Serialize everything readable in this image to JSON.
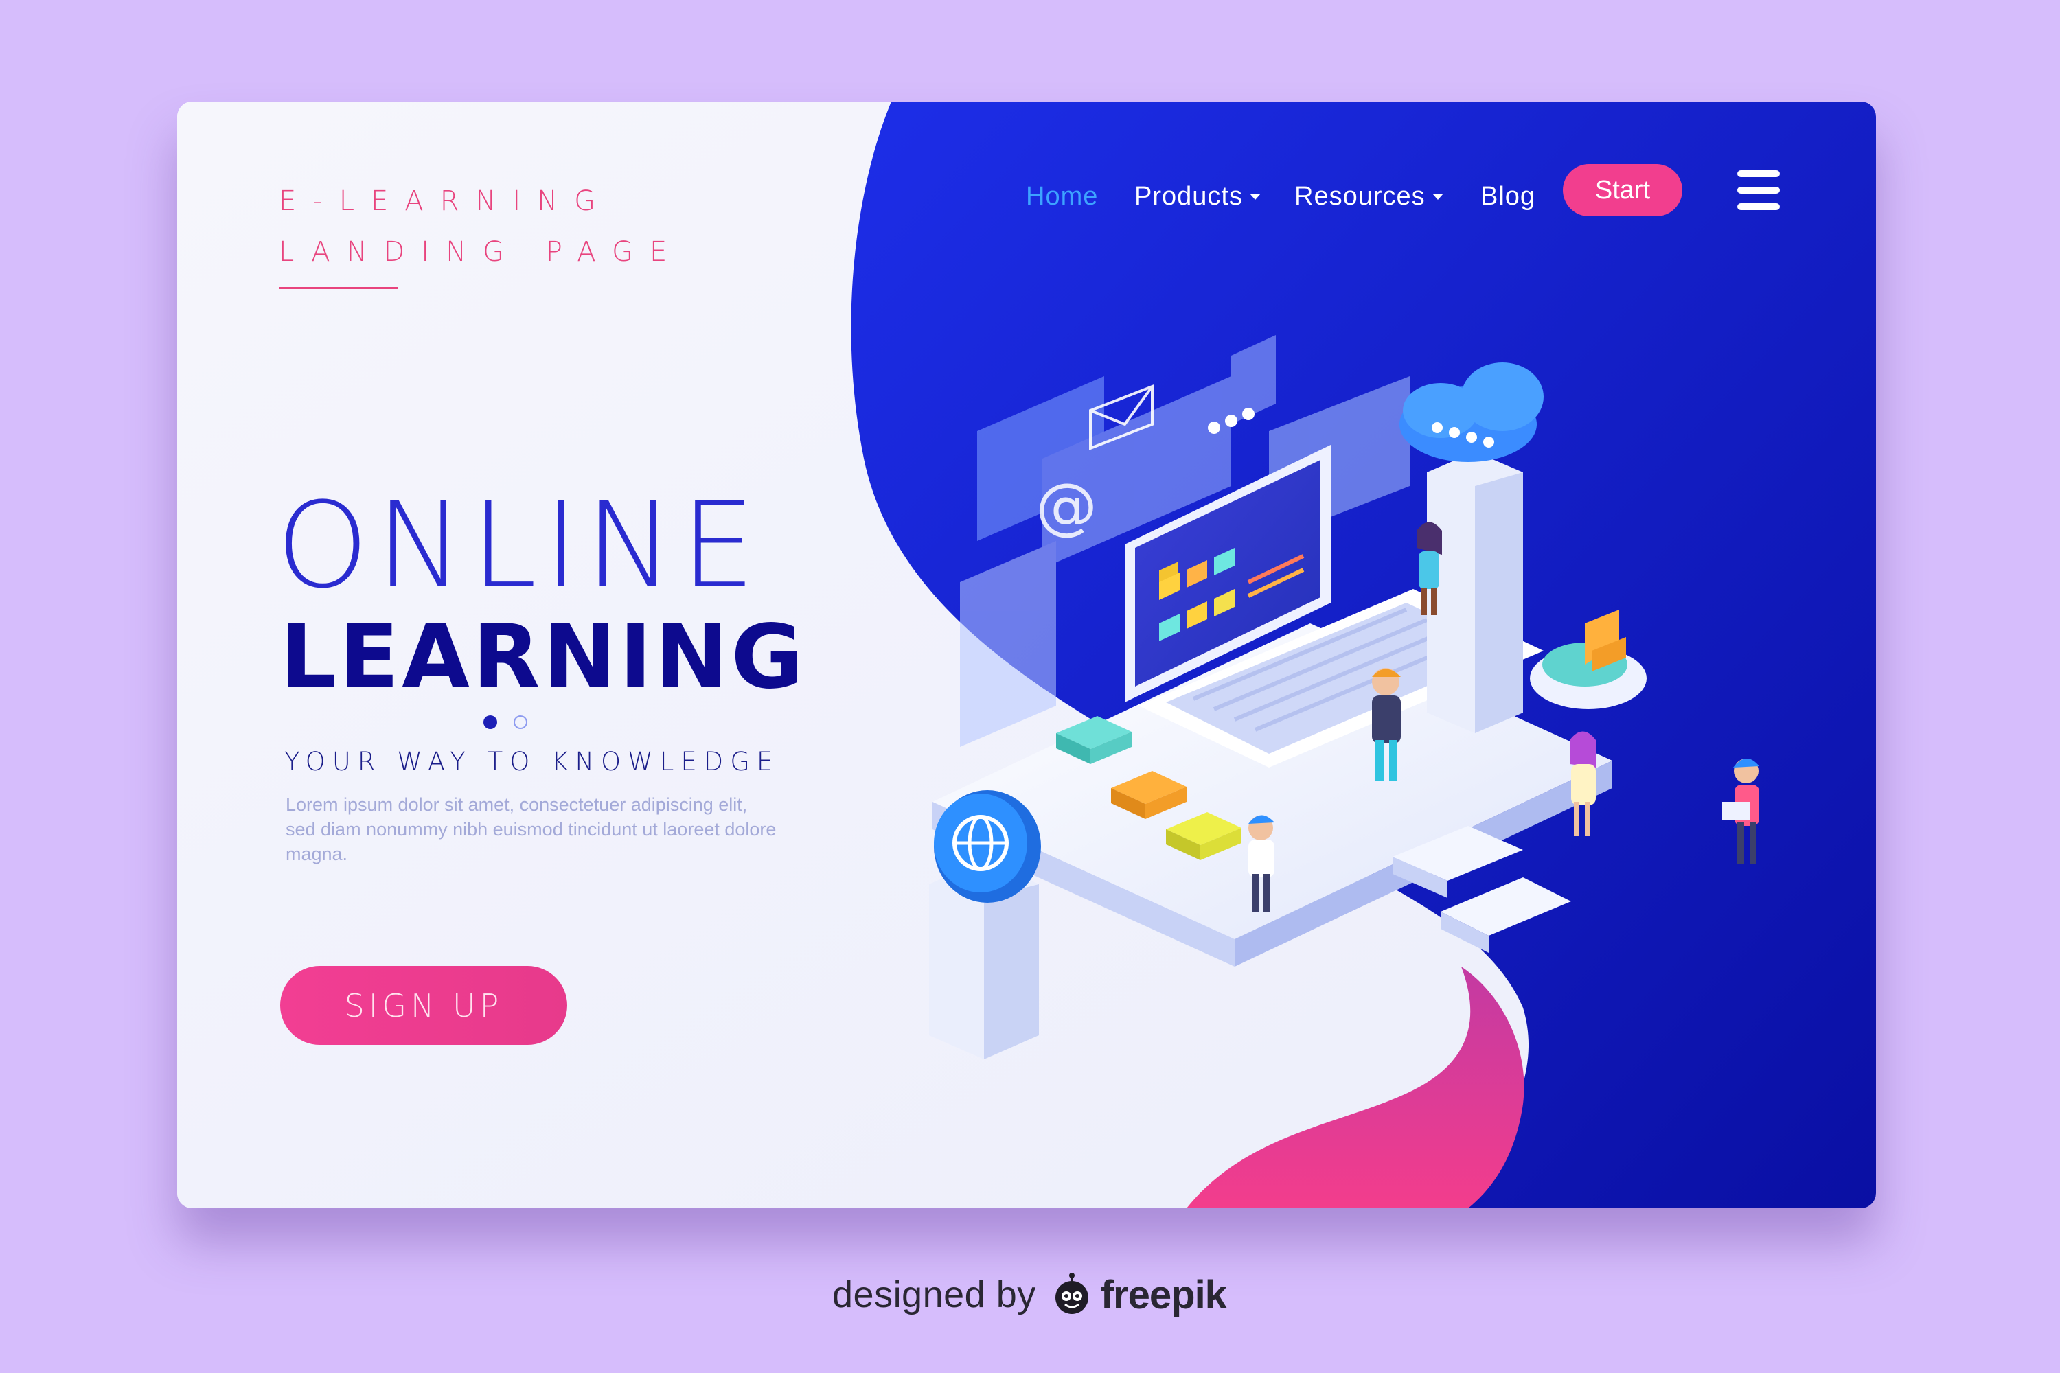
{
  "brand": {
    "line1": "E-LEARNING",
    "line2": "LANDING PAGE"
  },
  "nav": {
    "items": [
      {
        "label": "Home",
        "active": true,
        "has_caret": false
      },
      {
        "label": "Products",
        "active": false,
        "has_caret": true
      },
      {
        "label": "Resources",
        "active": false,
        "has_caret": true
      },
      {
        "label": "Blog",
        "active": false,
        "has_caret": false
      }
    ],
    "start_label": "Start",
    "menu_icon": "hamburger-menu-icon"
  },
  "hero": {
    "title_thin": "ONLINE",
    "title_bold": "LEARNING",
    "slider_dots": {
      "count": 2,
      "active_index": 0
    },
    "tagline": "YOUR WAY TO KNOWLEDGE",
    "description": "Lorem ipsum dolor sit amet, consectetuer adipiscing elit, sed diam nonummy nibh euismod tincidunt ut laoreet dolore magna.",
    "signup_label": "SIGN UP"
  },
  "illustration": {
    "icons": [
      "email-icon",
      "at-sign-icon",
      "cloud-icon",
      "globe-icon",
      "pie-chart-icon",
      "laptop-icon"
    ]
  },
  "credit": {
    "prefix": "designed by",
    "brand": "freepik"
  },
  "colors": {
    "page_bg": "#d6bdfc",
    "card_bg": "#f3f3fb",
    "blue_panel": "#1b24d8",
    "accent_pink": "#f23e8e",
    "title_blue": "#0d0a8e",
    "nav_active": "#3da3ff"
  }
}
